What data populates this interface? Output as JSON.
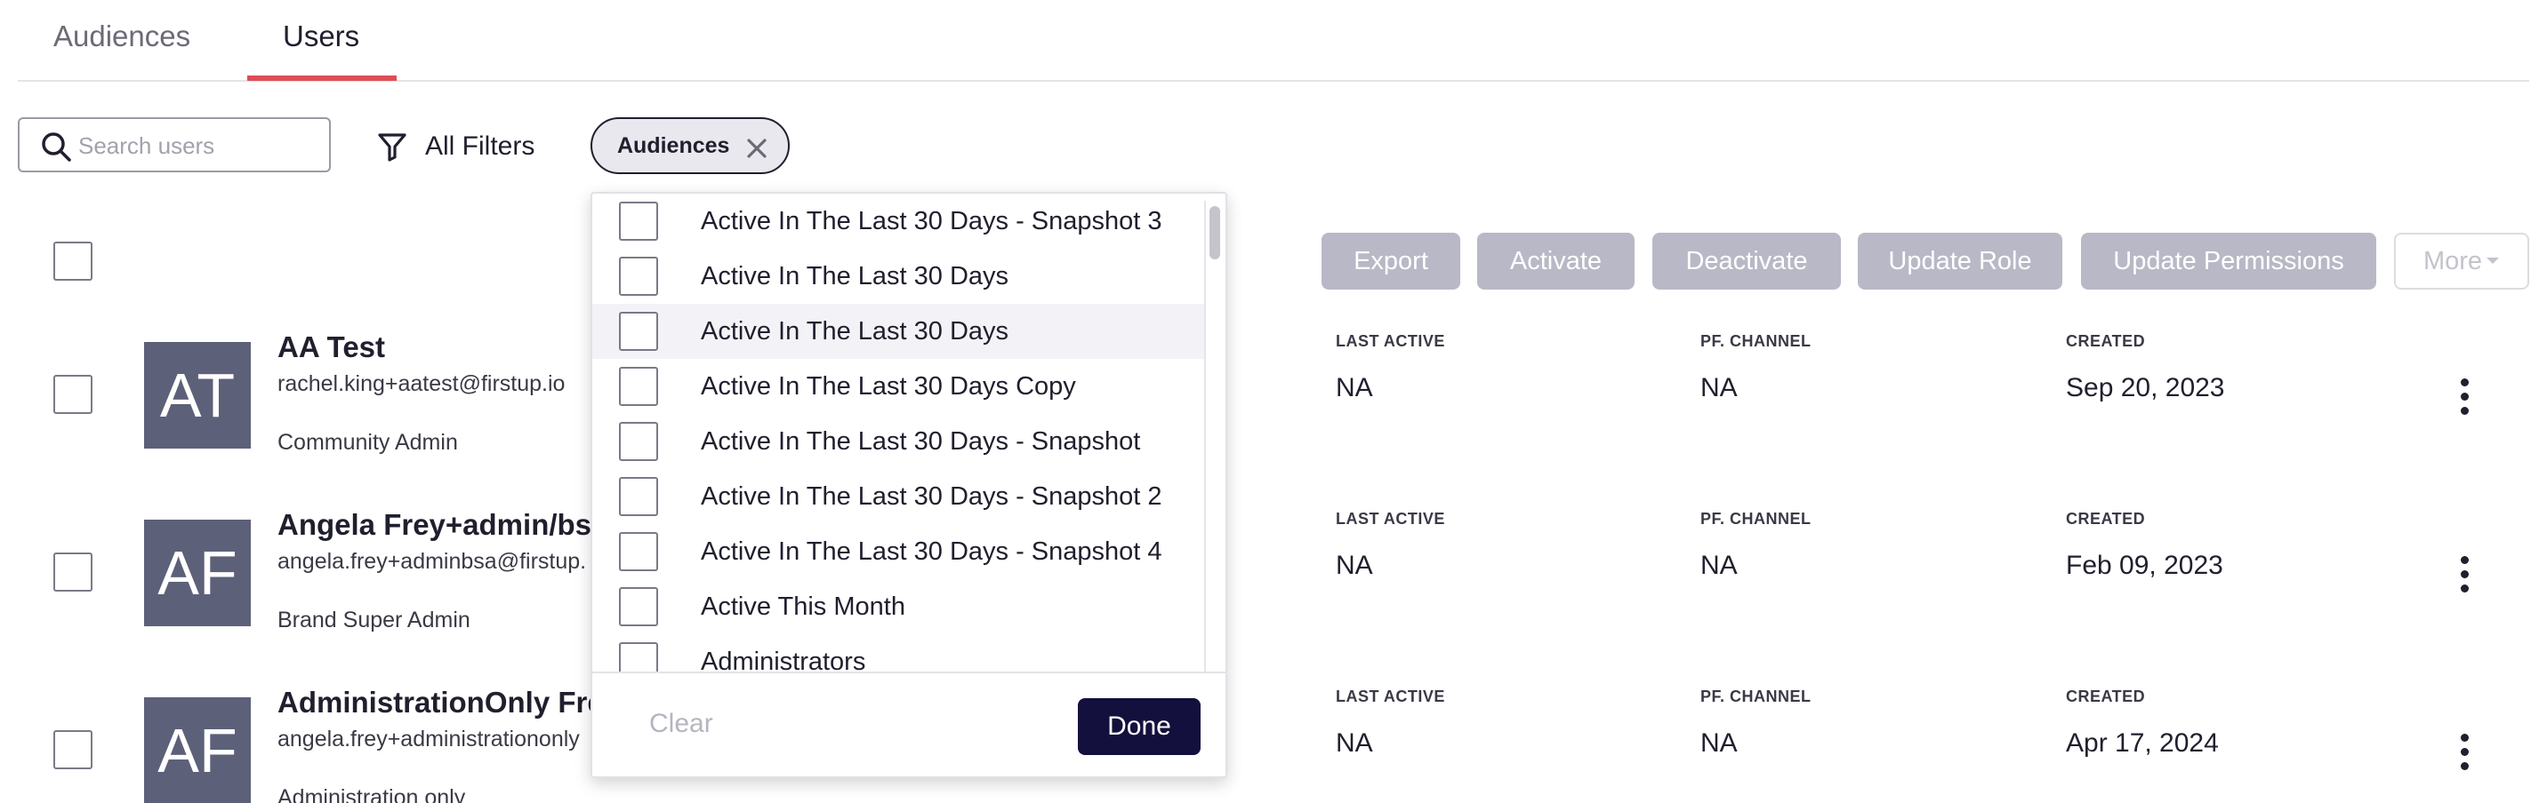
{
  "tabs": [
    {
      "label": "Audiences",
      "active": false
    },
    {
      "label": "Users",
      "active": true
    }
  ],
  "toolbar": {
    "search_placeholder": "Search users",
    "search_value": "",
    "filters_label": "All Filters",
    "chip_label": "Audiences"
  },
  "actions": {
    "export": "Export",
    "activate": "Activate",
    "deactivate": "Deactivate",
    "update_role": "Update Role",
    "update_permissions": "Update Permissions",
    "more": "More"
  },
  "columns": {
    "last_active": "LAST ACTIVE",
    "channel": "PF. CHANNEL",
    "created": "CREATED"
  },
  "users": [
    {
      "initials": "AT",
      "name": "AA Test",
      "email": "rachel.king+aatest@firstup.io",
      "role": "Community Admin",
      "last_active": "NA",
      "channel": "NA",
      "created": "Sep 20, 2023"
    },
    {
      "initials": "AF",
      "name": "Angela Frey+admin/bs",
      "email": "angela.frey+adminbsa@firstup.",
      "role": "Brand Super Admin",
      "last_active": "NA",
      "channel": "NA",
      "created": "Feb 09, 2023"
    },
    {
      "initials": "AF",
      "name": "AdministrationOnly Fre",
      "email": "angela.frey+administrationonly",
      "role": "Administration only",
      "last_active": "NA",
      "channel": "NA",
      "created": "Apr 17, 2024"
    }
  ],
  "dropdown": {
    "items": [
      "Active In The Last 30 Days - Snapshot 3",
      "Active In The Last 30 Days",
      "Active In The Last 30 Days",
      "Active In The Last 30 Days Copy",
      "Active In The Last 30 Days - Snapshot",
      "Active In The Last 30 Days - Snapshot 2",
      "Active In The Last 30 Days - Snapshot 4",
      "Active This Month",
      "Administrators"
    ],
    "clear_label": "Clear",
    "done_label": "Done"
  },
  "colors": {
    "accent_underline": "#de4d55",
    "done_button": "#14103d",
    "disabled_button": "#b8b8c6",
    "avatar_bg": "#5d6079"
  }
}
